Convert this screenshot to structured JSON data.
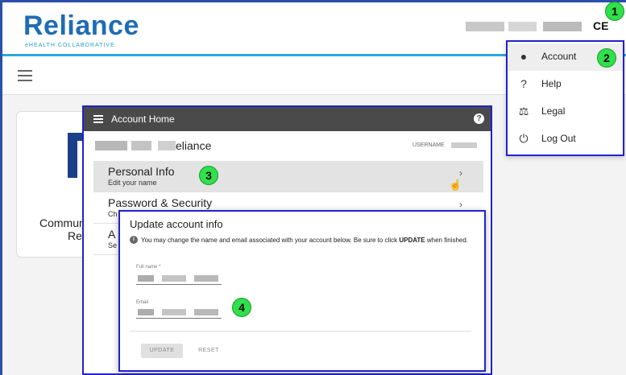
{
  "header": {
    "logo_text": "Reliance",
    "logo_subtitle": "eHEALTH COLLABORATIVE",
    "user_suffix": "CE"
  },
  "badges": [
    "1",
    "2",
    "3",
    "4"
  ],
  "card": {
    "title_line1": "Commun",
    "title_line2": "Re"
  },
  "menu": {
    "items": [
      {
        "label": "Account",
        "icon": "account-circle-icon",
        "glyph": "●"
      },
      {
        "label": "Help",
        "icon": "help-icon",
        "glyph": "?"
      },
      {
        "label": "Legal",
        "icon": "gavel-icon",
        "glyph": "⚖"
      },
      {
        "label": "Log Out",
        "icon": "power-icon",
        "glyph": "⏻"
      }
    ]
  },
  "account_home": {
    "title": "Account Home",
    "name_suffix": "eliance",
    "username_label": "USERNAME",
    "rows": [
      {
        "title": "Personal Info",
        "subtitle": "Edit your name"
      },
      {
        "title": "Password & Security",
        "subtitle": "Ch"
      },
      {
        "title": "A",
        "subtitle": "Se"
      }
    ]
  },
  "update_dialog": {
    "title": "Update account info",
    "message_pre": "You may change the name and email associated with your account below. Be sure to click ",
    "message_bold": "UPDATE",
    "message_post": " when finished.",
    "full_name_label": "Full name *",
    "email_label": "Email",
    "update_button": "UPDATE",
    "reset_button": "RESET"
  },
  "colors": {
    "brand_blue": "#1f6cb5",
    "accent_line": "#29a8e0",
    "annotation_green": "#2fe04a",
    "annotation_border": "#2222cc"
  }
}
